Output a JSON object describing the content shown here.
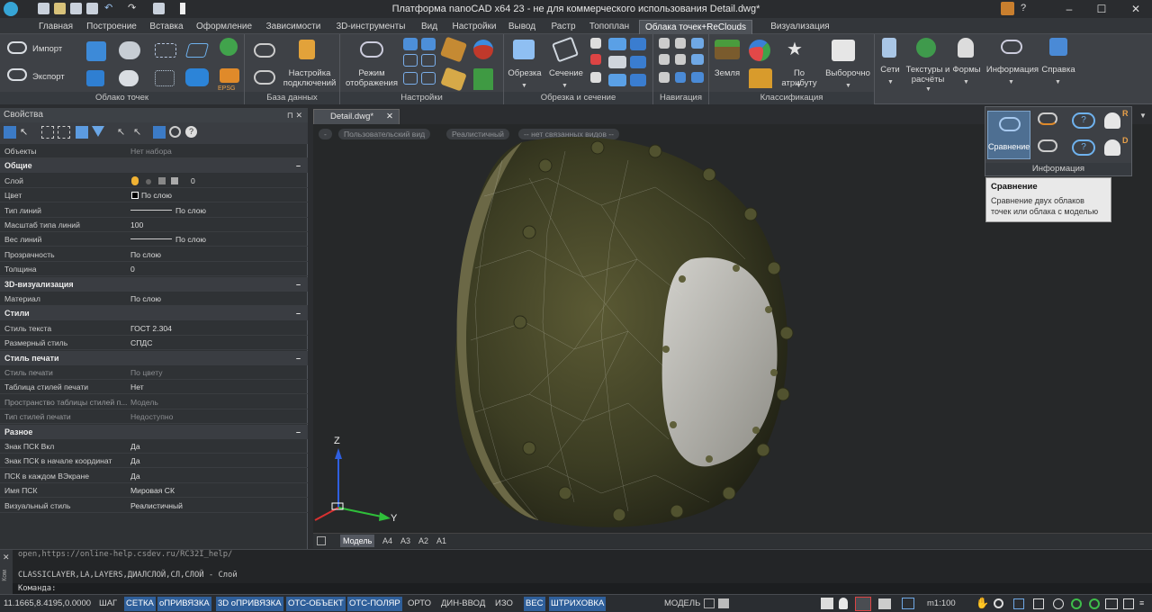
{
  "window": {
    "title": "Платформа nanoCAD x64 23 - не для коммерческого использования Detail.dwg*",
    "help_label": "?"
  },
  "ribbon_tabs": [
    "Главная",
    "Построение",
    "Вставка",
    "Оформление",
    "Зависимости",
    "3D-инструменты",
    "Вид",
    "Настройки",
    "Вывод",
    "Растр",
    "Топоплан",
    "Облака точек+ReClouds",
    "Визуализация ReClouds"
  ],
  "active_tab": "Облака точек+ReClouds",
  "ribbon": {
    "import_label": "Импорт",
    "export_label": "Экспорт",
    "epsg_label": "EPSG",
    "panel_cloud": "Облако точек",
    "connections_label": "Настройка подключений",
    "panel_db": "База данных",
    "display_mode_label": "Режим отображения",
    "panel_settings": "Настройки",
    "clip_label": "Обрезка",
    "section_label": "Сечение",
    "panel_clip": "Обрезка и сечение",
    "panel_nav": "Навигация",
    "ground_label": "Земля",
    "by_attr_label": "По атрибуту",
    "selective_label": "Выборочно",
    "panel_class": "Классификация",
    "nets_label": "Сети",
    "textures_label": "Текстуры и расчёты",
    "forms_label": "Формы",
    "info_label": "Информация",
    "help_label": "Справка"
  },
  "flyout": {
    "compare_label": "Сравнение",
    "badge_r": "R",
    "badge_d": "D",
    "panel_label": "Информация"
  },
  "tooltip": {
    "title": "Сравнение",
    "desc": "Сравнение двух облаков точек или облака с моделью"
  },
  "properties": {
    "header": "Свойства",
    "pin": "⊓ ✕",
    "selection_key": "Объекты",
    "selection_value": "Нет набора",
    "categories": [
      {
        "title": "Общие",
        "rows": [
          {
            "k": "Слой",
            "v": "0"
          },
          {
            "k": "Цвет",
            "v": "По слою"
          },
          {
            "k": "Тип линий",
            "v": "По слою"
          },
          {
            "k": "Масштаб типа линий",
            "v": "100"
          },
          {
            "k": "Вес линий",
            "v": "По слою"
          },
          {
            "k": "Прозрачность",
            "v": "По слою"
          },
          {
            "k": "Толщина",
            "v": "0"
          }
        ]
      },
      {
        "title": "3D-визуализация",
        "rows": [
          {
            "k": "Материал",
            "v": "По слою"
          }
        ]
      },
      {
        "title": "Стили",
        "rows": [
          {
            "k": "Стиль текста",
            "v": "ГОСТ 2.304"
          },
          {
            "k": "Размерный стиль",
            "v": "СПДС"
          }
        ]
      },
      {
        "title": "Стиль печати",
        "rows": [
          {
            "k": "Стиль печати",
            "v": "По цвету",
            "dim": true
          },
          {
            "k": "Таблица стилей печати",
            "v": "Нет"
          },
          {
            "k": "Пространство таблицы стилей п...",
            "v": "Модель",
            "dim": true
          },
          {
            "k": "Тип стилей печати",
            "v": "Недоступно",
            "dim": true
          }
        ]
      },
      {
        "title": "Разное",
        "rows": [
          {
            "k": "Знак ПСК Вкл",
            "v": "Да"
          },
          {
            "k": "Знак ПСК в начале координат",
            "v": "Да"
          },
          {
            "k": "ПСК в каждом ВЭкране",
            "v": "Да"
          },
          {
            "k": "Имя ПСК",
            "v": "Мировая СК"
          },
          {
            "k": "Визуальный стиль",
            "v": "Реалистичный"
          }
        ]
      }
    ]
  },
  "document": {
    "tab": "Detail.dwg*",
    "view_minus": "-",
    "view_name": "Пользовательский вид",
    "visual_style": "Реалистичный",
    "linked_views": "-- нет связанных видов --",
    "axis_z": "Z",
    "axis_y": "Y",
    "layout_tabs": [
      "Модель",
      "A4",
      "A3",
      "A2",
      "A1"
    ]
  },
  "command": {
    "line1": "open,https://online-help.csdev.ru/RC32I_help/",
    "line2": "CLASSICLAYER,LA,LAYERS,ДИАЛСЛОЙ,СЛ,СЛОЙ - Слой",
    "prompt": "Команда:",
    "side_label": "Ком"
  },
  "status": {
    "coords": "11.1665,8.4195,0.0000",
    "toggles": [
      {
        "label": "ШАГ",
        "on": false
      },
      {
        "label": "СЕТКА",
        "on": true
      },
      {
        "label": "оПРИВЯЗКА",
        "on": true
      },
      {
        "label": "3D оПРИВЯЗКА",
        "on": true
      },
      {
        "label": "ОТС-ОБЪЕКТ",
        "on": true
      },
      {
        "label": "ОТС-ПОЛЯР",
        "on": true
      },
      {
        "label": "ОРТО",
        "on": false
      },
      {
        "label": "ДИН-ВВОД",
        "on": false
      },
      {
        "label": "ИЗО",
        "on": false
      },
      {
        "label": "ВЕС",
        "on": true
      },
      {
        "label": "ШТРИХОВКА",
        "on": true
      }
    ],
    "model": "МОДЕЛЬ",
    "scale": "m1:100"
  }
}
